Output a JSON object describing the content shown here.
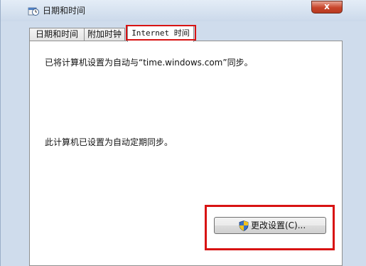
{
  "window": {
    "title": "日期和时间",
    "close_label": "x"
  },
  "tabs": [
    {
      "label": "日期和时间",
      "active": false
    },
    {
      "label": "附加时钟",
      "active": false
    },
    {
      "label": "Internet 时间",
      "active": true
    }
  ],
  "content": {
    "sync_status": "已将计算机设置为自动与“time.windows.com”同步。",
    "schedule_status": "此计算机已设置为自动定期同步。"
  },
  "change_settings_button": {
    "label": "更改设置(C)...",
    "icon": "uac-shield-icon"
  },
  "colors": {
    "highlight": "#d81313"
  }
}
